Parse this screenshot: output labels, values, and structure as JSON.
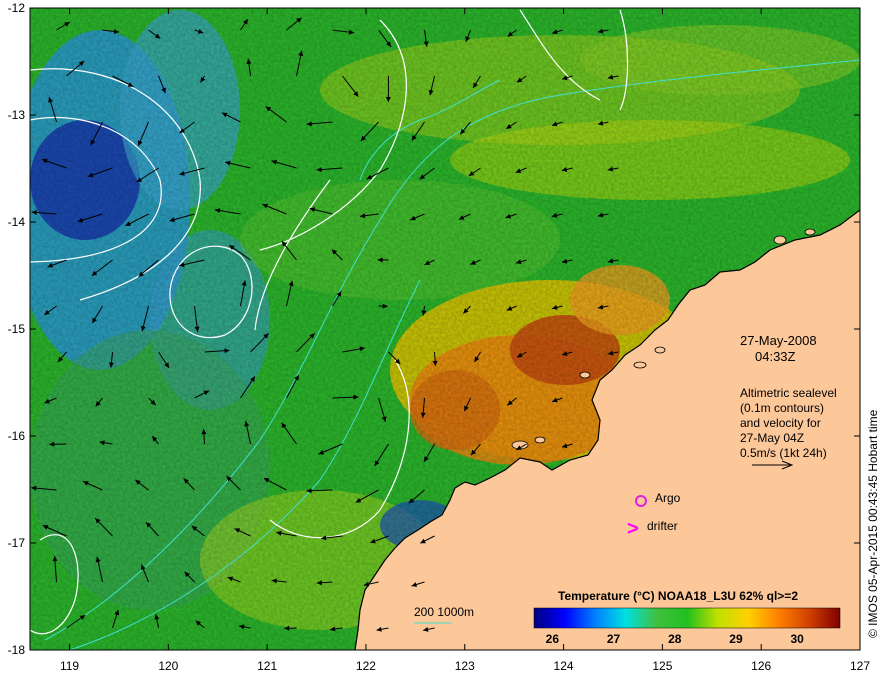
{
  "header": {
    "date": "27-May-2008",
    "time": "04:33Z"
  },
  "altimetry": {
    "line1": "Altimetric sealevel",
    "line2": "(0.1m contours)",
    "line3": "and velocity for",
    "line4": "27-May 04Z",
    "line5": "0.5m/s (1kt 24h)"
  },
  "markers": {
    "argo_label": "Argo",
    "drifter_label": "drifter",
    "drifter_symbol": ">"
  },
  "depth_legend": {
    "label": "200  1000m"
  },
  "colorbar": {
    "title": "Temperature (°C) NOAA18_L3U 62% ql>=2",
    "ticks": [
      "26",
      "27",
      "28",
      "29",
      "30"
    ],
    "tick_values": [
      26,
      27,
      28,
      29,
      30
    ],
    "range": [
      25.7,
      30.7
    ],
    "colors": [
      "#00007f",
      "#0000ff",
      "#0080ff",
      "#00e0e0",
      "#40c040",
      "#20c020",
      "#c0e000",
      "#ffd000",
      "#ff8000",
      "#d04000",
      "#7f0000"
    ]
  },
  "credit": "© IMOS 05-Apr-2015 00:43:45 Hobart time",
  "axes": {
    "x_ticks": [
      "119",
      "120",
      "121",
      "122",
      "123",
      "124",
      "125",
      "126",
      "127"
    ],
    "x_values": [
      119,
      120,
      121,
      122,
      123,
      124,
      125,
      126,
      127
    ],
    "y_ticks": [
      "-12",
      "-13",
      "-14",
      "-15",
      "-16",
      "-17",
      "-18"
    ],
    "y_values": [
      -12,
      -13,
      -14,
      -15,
      -16,
      -17,
      -18
    ],
    "lon_range": [
      118.6,
      127.0
    ],
    "lat_range": [
      -12.0,
      -18.0
    ]
  },
  "colors": {
    "land": "#fcc89a",
    "contour": "#ffffff",
    "bathymetry": "#40e0d0",
    "argo": "#e020e0",
    "drifter": "#ff00ff",
    "arrow": "#000000"
  }
}
